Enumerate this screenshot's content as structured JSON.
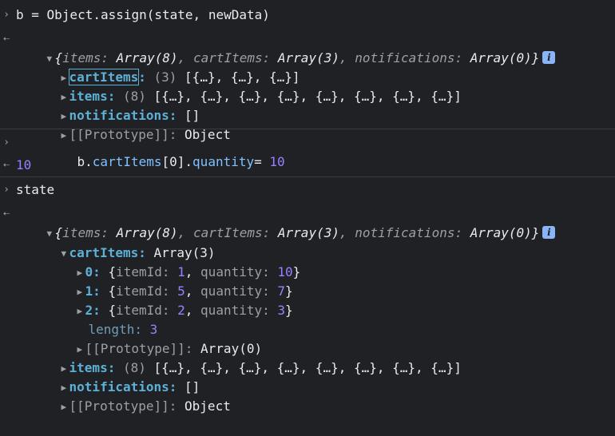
{
  "entries": {
    "cmd1": "b = Object.assign(state, newData)",
    "summary": {
      "open": "{",
      "k1": "items",
      "v1": "Array(8)",
      "k2": "cartItems",
      "v2": "Array(3)",
      "k3": "notifications",
      "v3": "Array(0)",
      "close": "}"
    },
    "result1": {
      "cartItems": {
        "key": "cartItems",
        "count": "(3)",
        "value": "[{…}, {…}, {…}]"
      },
      "items": {
        "key": "items",
        "count": "(8)",
        "value": "[{…}, {…}, {…}, {…}, {…}, {…}, {…}, {…}]"
      },
      "notifications": {
        "key": "notifications",
        "value": "[]"
      },
      "prototype": {
        "key": "[[Prototype]]",
        "value": "Object"
      }
    },
    "cmd2": {
      "obj": "b.",
      "prop": "cartItems",
      "idx": "0",
      "prop2": "quantity",
      "rest": "= ",
      "val": "10"
    },
    "out2": "10",
    "cmd3": "state",
    "result3": {
      "cartItems": {
        "key": "cartItems",
        "value": "Array(3)"
      },
      "rows": [
        {
          "index": "0",
          "idLabel": "itemId",
          "idVal": "1",
          "qLabel": "quantity",
          "qVal": "10"
        },
        {
          "index": "1",
          "idLabel": "itemId",
          "idVal": "5",
          "qLabel": "quantity",
          "qVal": "7"
        },
        {
          "index": "2",
          "idLabel": "itemId",
          "idVal": "2",
          "qLabel": "quantity",
          "qVal": "3"
        }
      ],
      "length": {
        "key": "length",
        "value": "3"
      },
      "arrProto": {
        "key": "[[Prototype]]",
        "value": "Array(0)"
      },
      "items": {
        "key": "items",
        "count": "(8)",
        "value": "[{…}, {…}, {…}, {…}, {…}, {…}, {…}, {…}]"
      },
      "notifications": {
        "key": "notifications",
        "value": "[]"
      },
      "prototype": {
        "key": "[[Prototype]]",
        "value": "Object"
      }
    }
  },
  "icons": {
    "info": "info-icon",
    "expand": "expand-triangle-icon",
    "collapse": "collapse-triangle-icon",
    "prompt": "prompt-chevron-icon",
    "result": "result-arrow-icon"
  },
  "colors": {
    "background": "#202124",
    "key": "#5db0d7",
    "number": "#9980ff",
    "text": "#e8eaed",
    "dim": "#9aa0a6"
  }
}
